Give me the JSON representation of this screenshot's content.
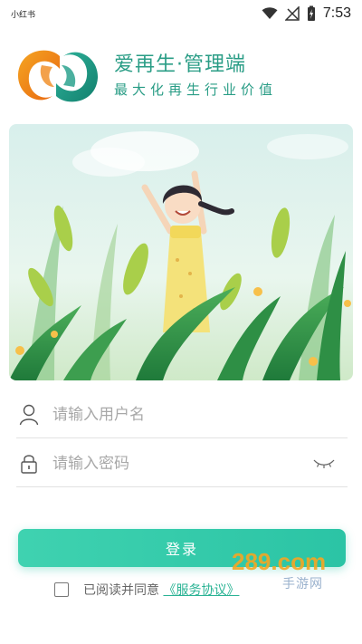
{
  "status_bar": {
    "carrier": "小红书",
    "time": "7:53",
    "icons": [
      "wifi-icon",
      "signal-off-icon",
      "battery-charging-icon"
    ]
  },
  "brand": {
    "title": "爱再生·管理端",
    "slogan": "最大化再生行业价值",
    "logo_icon": "recycle-logo-icon",
    "colors": {
      "orange": "#f08a1e",
      "teal": "#1e9c87"
    }
  },
  "banner": {
    "illustration": "girl-in-wheat-field-illustration"
  },
  "form": {
    "username": {
      "placeholder": "请输入用户名",
      "value": "",
      "icon": "user-icon"
    },
    "password": {
      "placeholder": "请输入密码",
      "value": "",
      "icon": "lock-icon",
      "toggle_icon": "eye-closed-icon"
    },
    "login_label": "登录",
    "accent": "#2bc4a5"
  },
  "agreement": {
    "prefix": "已阅读并同意",
    "link": "《服务协议》",
    "checked": false
  },
  "watermark": {
    "brand": "289.com",
    "sub": "手游网"
  }
}
